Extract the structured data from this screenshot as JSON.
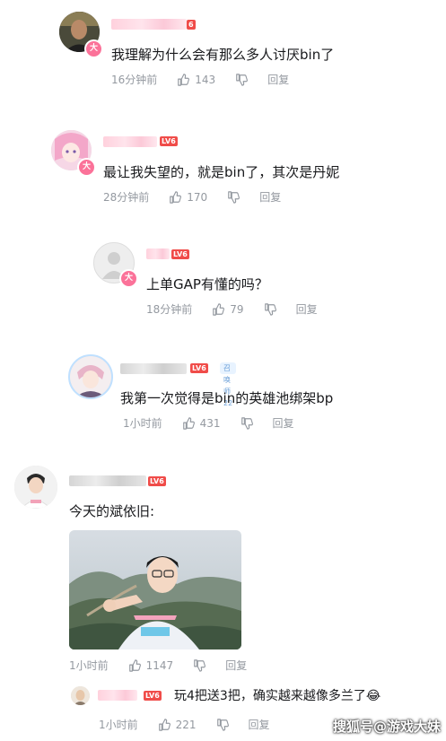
{
  "comments": [
    {
      "text": "我理解为什么会有那么多人讨厌bin了",
      "time": "16分钟前",
      "likes": "143",
      "reply": "回复",
      "badge": "大"
    },
    {
      "text": "最让我失望的，就是bin了，其次是丹妮",
      "time": "28分钟前",
      "likes": "170",
      "reply": "回复",
      "level": "LV6",
      "badge": "大"
    },
    {
      "text": "上单GAP有懂的吗？",
      "time": "18分钟前",
      "likes": "79",
      "reply": "回复",
      "level": "LV6",
      "badge": "大"
    },
    {
      "text": "我第一次觉得是bin的英雄池绑架bp",
      "time": "1小时前",
      "likes": "431",
      "reply": "回复",
      "level": "LV6",
      "fan_badge": "召唤师 22"
    },
    {
      "text": "今天的斌依旧:",
      "time": "1小时前",
      "likes": "1147",
      "reply": "回复",
      "level": "LV6"
    }
  ],
  "sub_reply": {
    "text": "玩4把送3把，确实越来越像多兰了",
    "emoji": "😂",
    "time": "1小时前",
    "likes": "221",
    "reply": "回复",
    "level": "LV6"
  },
  "watermark": "搜狐号@游戏大妹",
  "colors": {
    "accent_pink": "#fb7299",
    "level_red": "#f04c49",
    "meta_gray": "#9499a0"
  }
}
